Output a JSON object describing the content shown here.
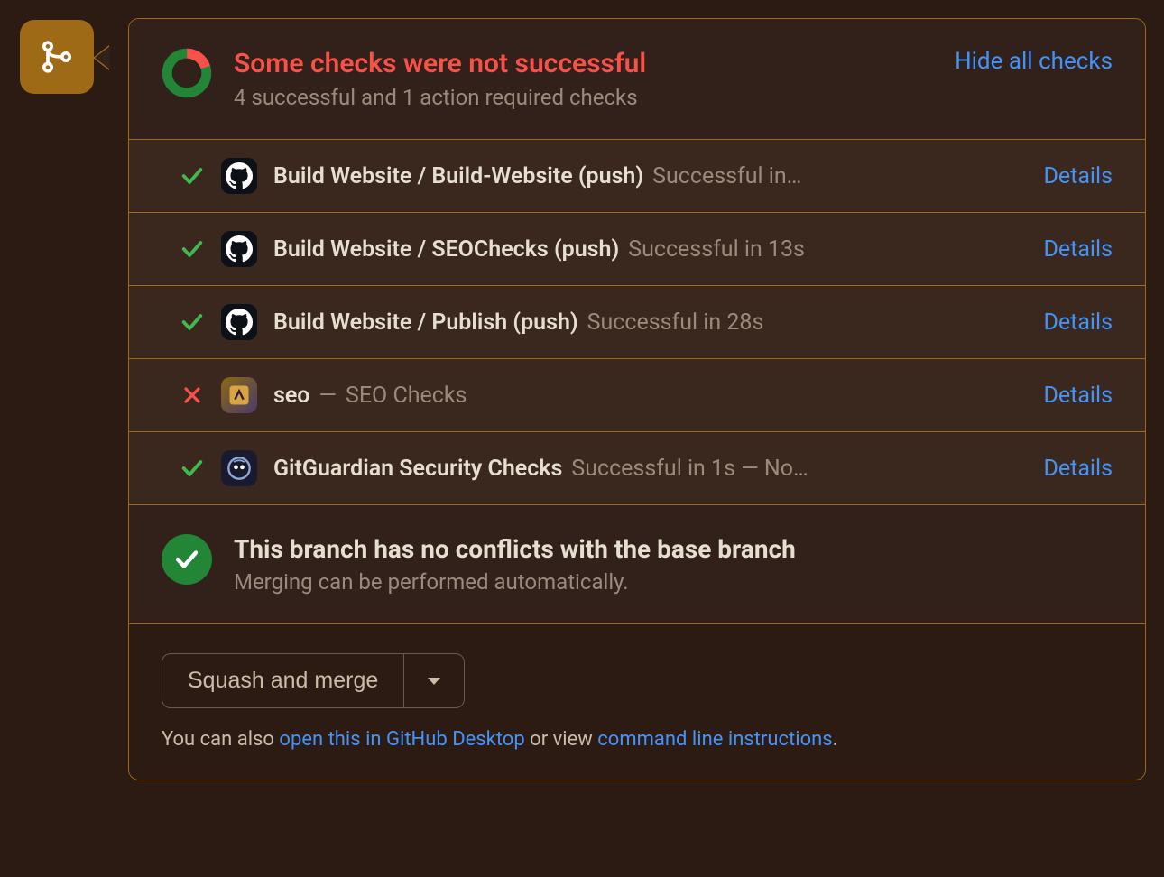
{
  "colors": {
    "accent": "#9e6a16",
    "link": "#4493f8",
    "error": "#f85149",
    "success": "#238636",
    "textPrimary": "#e6decf",
    "textSecondary": "#9b8a7c"
  },
  "header": {
    "title": "Some checks were not successful",
    "subtitle": "4 successful and 1 action required checks",
    "toggle_label": "Hide all checks"
  },
  "checks": [
    {
      "status": "success",
      "app_icon": "github",
      "name": "Build Website / Build-Website (push)",
      "status_text": "Successful in…",
      "details_label": "Details"
    },
    {
      "status": "success",
      "app_icon": "github",
      "name": "Build Website / SEOChecks (push)",
      "status_text": "Successful in 13s",
      "details_label": "Details"
    },
    {
      "status": "success",
      "app_icon": "github",
      "name": "Build Website / Publish (push)",
      "status_text": "Successful in 28s",
      "details_label": "Details"
    },
    {
      "status": "failure",
      "app_icon": "seo-app",
      "name": "seo",
      "separator": "—",
      "status_text": "SEO Checks",
      "details_label": "Details"
    },
    {
      "status": "success",
      "app_icon": "gitguardian",
      "name": "GitGuardian Security Checks",
      "status_text": "Successful in 1s — No…",
      "details_label": "Details"
    }
  ],
  "conflicts": {
    "title": "This branch has no conflicts with the base branch",
    "subtitle": "Merging can be performed automatically."
  },
  "actions": {
    "merge_label": "Squash and merge",
    "hint_prefix": "You can also ",
    "hint_link1": "open this in GitHub Desktop",
    "hint_mid": " or view ",
    "hint_link2": "command line instructions",
    "hint_suffix": "."
  }
}
